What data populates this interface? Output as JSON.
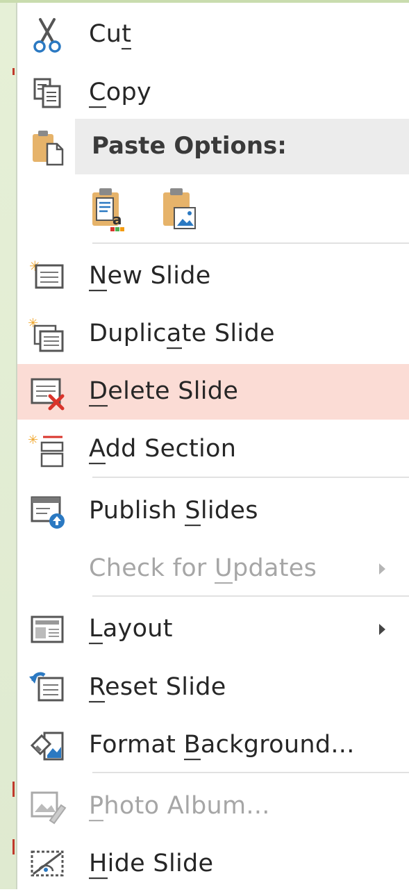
{
  "menu": {
    "cut": {
      "label_pre": "Cu",
      "label_key": "t",
      "label_post": "",
      "icon": "scissors-icon"
    },
    "copy": {
      "label_pre": "",
      "label_key": "C",
      "label_post": "opy",
      "icon": "copy-icon"
    },
    "paste_options": {
      "label": "Paste Options:",
      "icon": "clipboard-icon"
    },
    "paste_buttons": [
      {
        "name": "paste-keep-text-only-icon",
        "icon": "clipboard-text-icon"
      },
      {
        "name": "paste-picture-icon",
        "icon": "clipboard-picture-icon"
      }
    ],
    "new_slide": {
      "label_pre": "",
      "label_key": "N",
      "label_post": "ew Slide",
      "icon": "new-slide-icon"
    },
    "duplicate_slide": {
      "label_pre": "Duplic",
      "label_key": "a",
      "label_post": "te Slide",
      "icon": "duplicate-slide-icon"
    },
    "delete_slide": {
      "label_pre": "",
      "label_key": "D",
      "label_post": "elete Slide",
      "icon": "delete-slide-icon"
    },
    "add_section": {
      "label_pre": "",
      "label_key": "A",
      "label_post": "dd Section",
      "icon": "add-section-icon"
    },
    "publish_slides": {
      "label_pre": "Publish ",
      "label_key": "S",
      "label_post": "lides",
      "icon": "publish-slides-icon"
    },
    "check_updates": {
      "label_pre": "Check for ",
      "label_key": "U",
      "label_post": "pdates",
      "disabled": true
    },
    "layout": {
      "label_pre": "",
      "label_key": "L",
      "label_post": "ayout",
      "icon": "layout-icon"
    },
    "reset_slide": {
      "label_pre": "",
      "label_key": "R",
      "label_post": "eset Slide",
      "icon": "reset-slide-icon"
    },
    "format_background": {
      "label_pre": "Format ",
      "label_key": "B",
      "label_post": "ackground...",
      "icon": "format-background-icon"
    },
    "photo_album": {
      "label_pre": "",
      "label_key": "P",
      "label_post": "hoto Album...",
      "icon": "photo-album-icon",
      "disabled": true
    },
    "hide_slide": {
      "label_pre": "",
      "label_key": "H",
      "label_post": "ide Slide",
      "icon": "hide-slide-icon"
    }
  },
  "colors": {
    "highlight": "#fbdcd5",
    "paste_header_bg": "#ececec",
    "text": "#262626",
    "disabled_text": "#a6a6a6",
    "accent_blue": "#2b79c2",
    "delete_red": "#d9342b",
    "clipboard_tan": "#e6b36a"
  }
}
